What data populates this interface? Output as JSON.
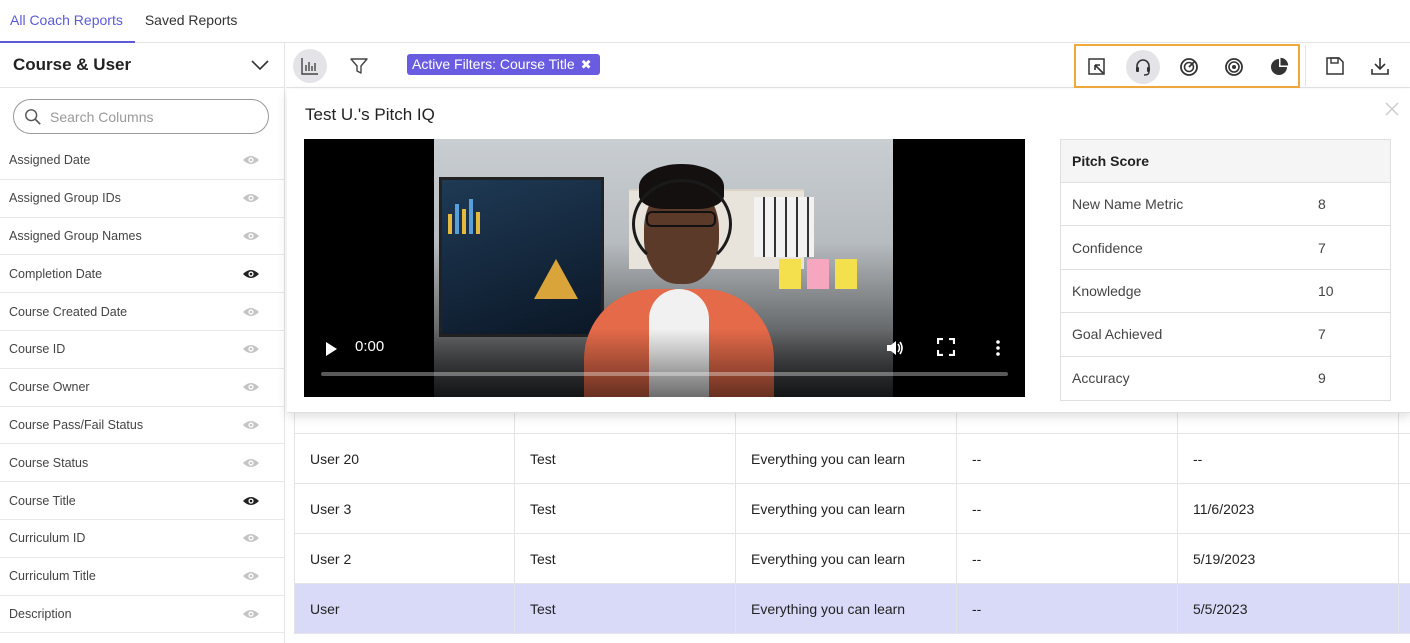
{
  "tabs": [
    {
      "label": "All Coach Reports",
      "active": true
    },
    {
      "label": "Saved Reports",
      "active": false
    }
  ],
  "sidebar": {
    "title": "Course & User",
    "search_placeholder": "Search Columns",
    "columns": [
      {
        "label": "Assigned Date",
        "visible": false
      },
      {
        "label": "Assigned Group IDs",
        "visible": false
      },
      {
        "label": "Assigned Group Names",
        "visible": false
      },
      {
        "label": "Completion Date",
        "visible": true
      },
      {
        "label": "Course Created Date",
        "visible": false
      },
      {
        "label": "Course ID",
        "visible": false
      },
      {
        "label": "Course Owner",
        "visible": false
      },
      {
        "label": "Course Pass/Fail Status",
        "visible": false
      },
      {
        "label": "Course Status",
        "visible": false
      },
      {
        "label": "Course Title",
        "visible": true
      },
      {
        "label": "Curriculum ID",
        "visible": false
      },
      {
        "label": "Curriculum Title",
        "visible": false
      },
      {
        "label": "Description",
        "visible": false
      }
    ]
  },
  "toolbar": {
    "active_filter_label": "Active Filters: Course Title",
    "accent_color": "#6a5ce0",
    "highlight_color": "#f0a93b"
  },
  "popover": {
    "title": "Test U.'s Pitch IQ",
    "video": {
      "time": "0:00"
    },
    "score_table": {
      "header": "Pitch Score",
      "rows": [
        {
          "label": "New Name Metric",
          "value": "8"
        },
        {
          "label": "Confidence",
          "value": "7"
        },
        {
          "label": "Knowledge",
          "value": "10"
        },
        {
          "label": "Goal Achieved",
          "value": "7"
        },
        {
          "label": "Accuracy",
          "value": "9"
        }
      ]
    }
  },
  "table": {
    "rows": [
      {
        "cells": [
          "User 20",
          "Test",
          "Everything you can learn",
          "--",
          "--"
        ],
        "selected": false
      },
      {
        "cells": [
          "User 3",
          "Test",
          "Everything you can learn",
          "--",
          "11/6/2023"
        ],
        "selected": false
      },
      {
        "cells": [
          "User 2",
          "Test",
          "Everything you can learn",
          "--",
          "5/19/2023"
        ],
        "selected": false
      },
      {
        "cells": [
          "User",
          "Test",
          "Everything you can learn",
          "--",
          "5/5/2023"
        ],
        "selected": true
      }
    ]
  }
}
